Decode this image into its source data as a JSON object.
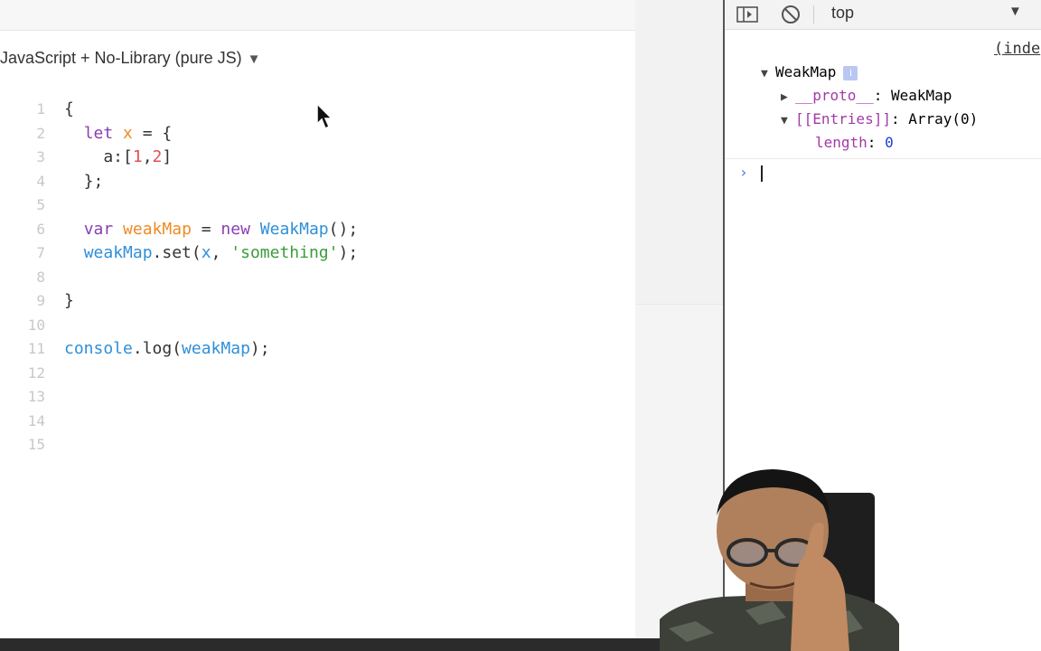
{
  "editor": {
    "language_label": "JavaScript + No-Library (pure JS)",
    "lines": [
      {
        "n": "1",
        "tokens": [
          {
            "t": "{",
            "c": ""
          }
        ]
      },
      {
        "n": "2",
        "tokens": [
          {
            "t": "  ",
            "c": ""
          },
          {
            "t": "let",
            "c": "kw"
          },
          {
            "t": " ",
            "c": ""
          },
          {
            "t": "x",
            "c": "var"
          },
          {
            "t": " = {",
            "c": ""
          }
        ]
      },
      {
        "n": "3",
        "tokens": [
          {
            "t": "    a:[",
            "c": ""
          },
          {
            "t": "1",
            "c": "num"
          },
          {
            "t": ",",
            "c": ""
          },
          {
            "t": "2",
            "c": "num"
          },
          {
            "t": "]",
            "c": ""
          }
        ]
      },
      {
        "n": "4",
        "tokens": [
          {
            "t": "  };",
            "c": ""
          }
        ]
      },
      {
        "n": "5",
        "tokens": []
      },
      {
        "n": "6",
        "tokens": [
          {
            "t": "  ",
            "c": ""
          },
          {
            "t": "var",
            "c": "kw"
          },
          {
            "t": " ",
            "c": ""
          },
          {
            "t": "weakMap",
            "c": "var"
          },
          {
            "t": " = ",
            "c": ""
          },
          {
            "t": "new",
            "c": "kw"
          },
          {
            "t": " ",
            "c": ""
          },
          {
            "t": "WeakMap",
            "c": "fn"
          },
          {
            "t": "();",
            "c": ""
          }
        ]
      },
      {
        "n": "7",
        "tokens": [
          {
            "t": "  ",
            "c": ""
          },
          {
            "t": "weakMap",
            "c": "fn"
          },
          {
            "t": ".set(",
            "c": ""
          },
          {
            "t": "x",
            "c": "fn"
          },
          {
            "t": ", ",
            "c": ""
          },
          {
            "t": "'something'",
            "c": "str"
          },
          {
            "t": ");",
            "c": ""
          }
        ]
      },
      {
        "n": "8",
        "tokens": []
      },
      {
        "n": "9",
        "tokens": [
          {
            "t": "}",
            "c": ""
          }
        ]
      },
      {
        "n": "10",
        "tokens": []
      },
      {
        "n": "11",
        "tokens": [
          {
            "t": "console",
            "c": "fn"
          },
          {
            "t": ".log(",
            "c": ""
          },
          {
            "t": "weakMap",
            "c": "fn"
          },
          {
            "t": ");",
            "c": ""
          }
        ]
      },
      {
        "n": "12",
        "tokens": []
      },
      {
        "n": "13",
        "tokens": []
      },
      {
        "n": "14",
        "tokens": []
      },
      {
        "n": "15",
        "tokens": []
      }
    ]
  },
  "devtools": {
    "context": "top",
    "source_link": "(inde",
    "object": {
      "name": "WeakMap",
      "info": "i",
      "proto_key": "__proto__",
      "proto_sep": ": ",
      "proto_value": "WeakMap",
      "entries_key": "[[Entries]]",
      "entries_sep": ": ",
      "entries_value": "Array(0)",
      "length_key": "length",
      "length_sep": ": ",
      "length_value": "0"
    },
    "prompt": "›"
  },
  "icons": {
    "sidebar_toggle": "sidebar-toggle-icon",
    "clear": "clear-console-icon",
    "dropdown": "dropdown-arrow-icon"
  }
}
